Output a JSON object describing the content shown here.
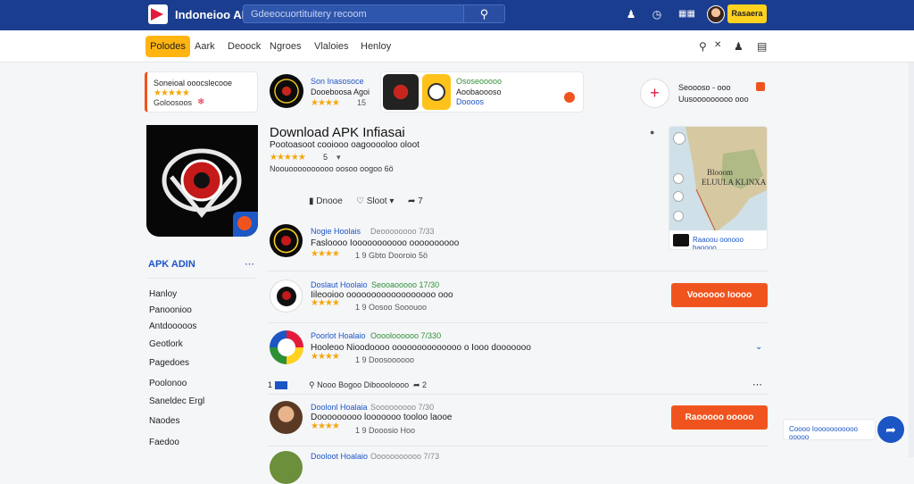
{
  "header": {
    "brand": "Indoneioo APK",
    "search_placeholder": "Gdeeocuortituitery recoom",
    "cta_label": "Rasaera"
  },
  "nav": {
    "active": "Polodes",
    "items": [
      "Aark",
      "Deoock",
      "Ngroes",
      "Vlaloies",
      "Henloy"
    ]
  },
  "promo": {
    "title": "Soneioal ooocslecooe",
    "subtitle": "Goloosoos"
  },
  "featured": {
    "name": "Son Inasosoce",
    "desc": "Dooeboosa Agoi",
    "rating_text": "15"
  },
  "featured2": {
    "name": "Ososeooooo",
    "line2": "Aoobaoooso",
    "line3": "Doooos"
  },
  "rightcard": {
    "title": "Seoooso - ooo",
    "line2": "Uusooooooooo ooo"
  },
  "main": {
    "title": "Download APK Infiasai",
    "subtitle": "Pootoasoot cooiooo oagooooloo oloot",
    "rating_num": "5",
    "meta": "Noouoooooooooo oosoo oogoo 6ö",
    "like": "Dnooe",
    "save": "Sloot",
    "share": "7"
  },
  "map": {
    "label_a": "Blooom",
    "label_b": "ELUULA KLINXA",
    "footer": "Raaoou oonooo baoooo"
  },
  "sidebar": {
    "section": "APK ADIN",
    "items": [
      "Hanloy",
      "Panoonioo",
      "Antdooooos",
      "Geotlork",
      "Pagedoes",
      "Poolonoo",
      "Saneldec Ergl",
      "Naodes",
      "Faedoo"
    ]
  },
  "apps": [
    {
      "name": "Nogie Hoolais",
      "tag": "Deoooooooo 7/33",
      "desc": "Fasloooo Iooooooooooo oooooooooo",
      "meta": "1 9 Gbto Dooroio 5ö"
    },
    {
      "name": "Doslaut Hoolaio",
      "tag": "Seooaooooo 17/30",
      "desc": "Iileooioo oooooooooooooooooo ooo",
      "meta": "1 9 Oosoo Sooouoo",
      "button": "Voooooo Ioooo"
    },
    {
      "name": "Poorlot Hoalaio",
      "tag": "Ooooloooooo 7/330",
      "desc": "Hooleoo Nioodoooo oooooooooooooo o Iooo dooooooo",
      "meta": "1 9 Doosoooooo"
    },
    {
      "name": "Doolonl Hoalaia",
      "tag": "Sooooooooo 7/30",
      "desc": "Dooooooooo looooooo tooloo laooe",
      "meta": "1 9 Dooosio Hoo",
      "button": "Raooooo ooooo"
    },
    {
      "name": "Dooloot Hoalaio",
      "tag": "Ooooooooooo 7/73"
    }
  ],
  "actions_row": {
    "count": "1",
    "mid": "Nooo Bogoo Diboooloooo",
    "share": "2"
  },
  "chat": {
    "text": "Coooo Iooooooooooo ooooo"
  },
  "colors": {
    "header": "#1a3d8f",
    "accent_yellow": "#ffd21f",
    "button_orange": "#f0541e",
    "link_blue": "#1c55c4"
  }
}
